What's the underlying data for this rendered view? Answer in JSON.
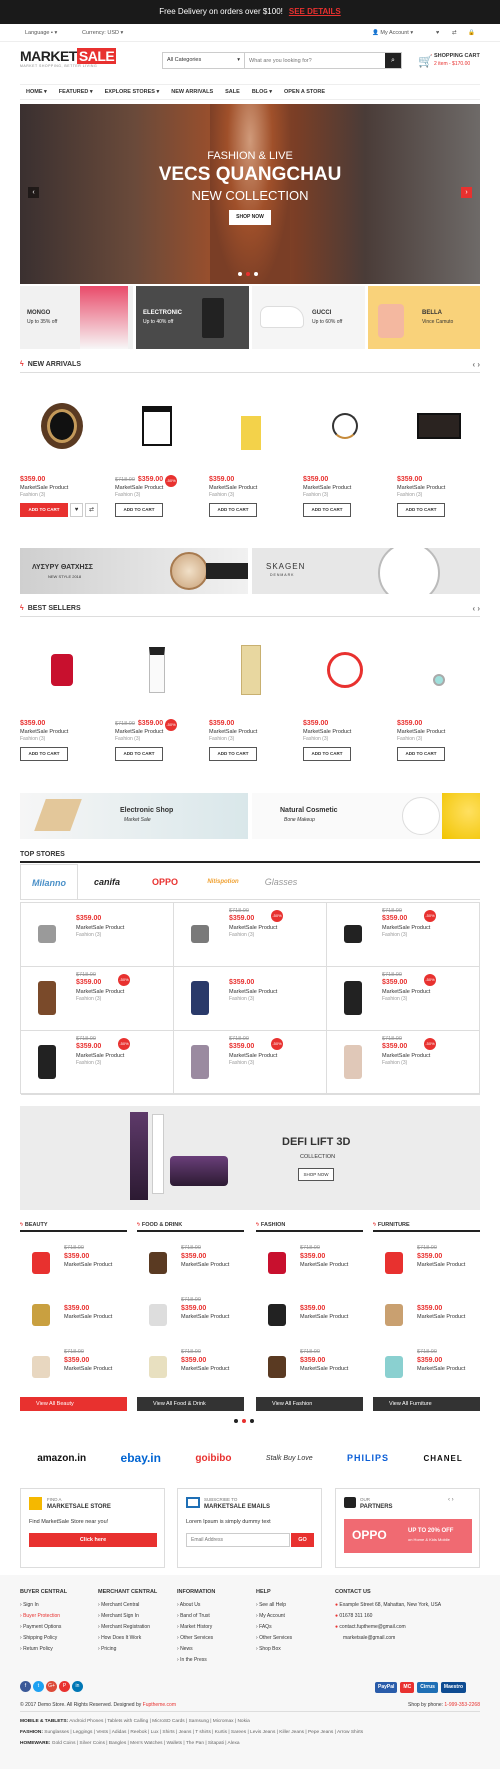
{
  "topbar": {
    "text": "Free Delivery on orders over $100!",
    "link": "SEE DETAILS"
  },
  "util": {
    "language_label": "Language",
    "currency_label": "Currency: USD",
    "account": "My Account"
  },
  "logo": {
    "part1": "MARKET",
    "part2": "SALE",
    "tagline": "MARKET SHOPPING, BETTER LIVING"
  },
  "search": {
    "category": "All Categories",
    "placeholder": "What are you looking for?"
  },
  "cart": {
    "title": "SHOPPING CART",
    "summary": "2 item - $170.00"
  },
  "nav": [
    "HOME",
    "FEATURED",
    "EXPLORE STORES",
    "NEW ARRIVALS",
    "SALE",
    "BLOG",
    "OPEN A STORE"
  ],
  "hero": {
    "line1": "FASHION & LIVE",
    "line2": "VECS QUANGCHAU",
    "line3": "NEW COLLECTION",
    "button": "SHOP NOW"
  },
  "promo_cards": [
    {
      "title": "MONGO",
      "subtitle": "Up to 35% off"
    },
    {
      "title": "ELECTRONIC",
      "subtitle": "Up to 40% off"
    },
    {
      "title": "GUCCI",
      "subtitle": "Up to 60% off"
    },
    {
      "title": "BELLA",
      "subtitle": "Vince Camuto"
    }
  ],
  "new_arrivals": {
    "title": "NEW ARRIVALS",
    "products": [
      {
        "price": "$359.00",
        "old": "",
        "sale": "",
        "name": "MarketSale Product",
        "cat": "Fashion (3)",
        "icon": "watch"
      },
      {
        "price": "$359.00",
        "old": "$718.00",
        "sale": "-50%",
        "name": "MarketSale Product",
        "cat": "Fashion (3)",
        "icon": "side-table"
      },
      {
        "price": "$359.00",
        "old": "",
        "sale": "",
        "name": "MarketSale Product",
        "cat": "Fashion (3)",
        "icon": "diffuser"
      },
      {
        "price": "$359.00",
        "old": "",
        "sale": "",
        "name": "MarketSale Product",
        "cat": "Fashion (3)",
        "icon": "lamp"
      },
      {
        "price": "$359.00",
        "old": "",
        "sale": "",
        "name": "MarketSale Product",
        "cat": "Fashion (3)",
        "icon": "tv-stand"
      }
    ],
    "add_label": "ADD TO CART"
  },
  "mid_banners": {
    "left_title": "ΛΥΣΥΡΥ ΘΑΤΧΗΣΣ",
    "left_sub": "NEW STYLE 2018",
    "right_title": "SKAGEN",
    "right_sub": "DENMARK"
  },
  "best_sellers": {
    "title": "BEST SELLERS",
    "products": [
      {
        "price": "$359.00",
        "old": "",
        "sale": "",
        "name": "MarketSale Product",
        "cat": "Fashion (3)",
        "icon": "perfume"
      },
      {
        "price": "$359.00",
        "old": "$718.00",
        "sale": "-50%",
        "name": "MarketSale Product",
        "cat": "Fashion (3)",
        "icon": "bottle"
      },
      {
        "price": "$359.00",
        "old": "",
        "sale": "",
        "name": "MarketSale Product",
        "cat": "Fashion (3)",
        "icon": "cream"
      },
      {
        "price": "$359.00",
        "old": "",
        "sale": "",
        "name": "MarketSale Product",
        "cat": "Fashion (3)",
        "icon": "hugo"
      },
      {
        "price": "$359.00",
        "old": "",
        "sale": "",
        "name": "MarketSale Product",
        "cat": "Fashion (3)",
        "icon": "earrings"
      }
    ],
    "add_label": "ADD TO CART"
  },
  "shop_banners": {
    "left_title": "Electronic Shop",
    "left_sub": "Market Sale",
    "right_title": "Natural Cosmetic",
    "right_sub": "Bone Makeup"
  },
  "top_stores": {
    "title": "TOP STORES",
    "brands": [
      "Milanno",
      "canifa",
      "OPPO",
      "Nitispotion",
      "Glasses"
    ],
    "items": [
      {
        "old": "",
        "price": "$359.00",
        "badge": "",
        "name": "MarketSale Product",
        "cat": "Fashion (3)"
      },
      {
        "old": "$718.00",
        "price": "$359.00",
        "badge": "-50%",
        "name": "MarketSale Product",
        "cat": "Fashion (3)"
      },
      {
        "old": "$718.00",
        "price": "$359.00",
        "badge": "-50%",
        "name": "MarketSale Product",
        "cat": "Fashion (3)"
      },
      {
        "old": "$718.00",
        "price": "$359.00",
        "badge": "-50%",
        "name": "MarketSale Product",
        "cat": "Fashion (3)"
      },
      {
        "old": "",
        "price": "$359.00",
        "badge": "",
        "name": "MarketSale Product",
        "cat": "Fashion (3)"
      },
      {
        "old": "$718.00",
        "price": "$359.00",
        "badge": "-50%",
        "name": "MarketSale Product",
        "cat": "Fashion (3)"
      },
      {
        "old": "$718.00",
        "price": "$359.00",
        "badge": "-50%",
        "name": "MarketSale Product",
        "cat": "Fashion (3)"
      },
      {
        "old": "$718.00",
        "price": "$359.00",
        "badge": "-50%",
        "name": "MarketSale Product",
        "cat": "Fashion (3)"
      },
      {
        "old": "$718.00",
        "price": "$359.00",
        "badge": "-50%",
        "name": "MarketSale Product",
        "cat": "Fashion (3)"
      }
    ]
  },
  "defi": {
    "title": "DEFI LIFT 3D",
    "sub": "COLLECTION",
    "button": "SHOP NOW"
  },
  "categories": [
    {
      "title": "BEAUTY",
      "view": "View All Beauty",
      "color": "#e8312f",
      "items": [
        {
          "old": "$718.00",
          "price": "$359.00",
          "name": "MarketSale Product"
        },
        {
          "old": "",
          "price": "$359.00",
          "name": "MarketSale Product"
        },
        {
          "old": "$718.00",
          "price": "$359.00",
          "name": "MarketSale Product"
        }
      ]
    },
    {
      "title": "FOOD & DRINK",
      "view": "View All Food & Drink",
      "color": "#333333",
      "items": [
        {
          "old": "$718.00",
          "price": "$359.00",
          "name": "MarketSale Product"
        },
        {
          "old": "$718.00",
          "price": "$359.00",
          "name": "MarketSale Product"
        },
        {
          "old": "$718.00",
          "price": "$359.00",
          "name": "MarketSale Product"
        }
      ]
    },
    {
      "title": "FASHION",
      "view": "View All Fashion",
      "color": "#333333",
      "items": [
        {
          "old": "$718.00",
          "price": "$359.00",
          "name": "MarketSale Product"
        },
        {
          "old": "",
          "price": "$359.00",
          "name": "MarketSale Product"
        },
        {
          "old": "$718.00",
          "price": "$359.00",
          "name": "MarketSale Product"
        }
      ]
    },
    {
      "title": "FURNITURE",
      "view": "View All Furniture",
      "color": "#333333",
      "items": [
        {
          "old": "$718.00",
          "price": "$359.00",
          "name": "MarketSale Product"
        },
        {
          "old": "",
          "price": "$359.00",
          "name": "MarketSale Product"
        },
        {
          "old": "$718.00",
          "price": "$359.00",
          "name": "MarketSale Product"
        }
      ]
    }
  ],
  "brand_logos": [
    "amazon.in",
    "ebay.in",
    "goibibo",
    "Stalk Buy Love",
    "PHILIPS",
    "CHANEL"
  ],
  "panels": {
    "find": {
      "small": "FIND A",
      "title": "MARKETSALE STORE",
      "text": "Find MarketSale Store near you!",
      "button": "Click here"
    },
    "subscribe": {
      "small": "SUBSCRIBE TO",
      "title": "MARKETSALE EMAILS",
      "text": "Lorem Ipsum is simply dummy text",
      "placeholder": "Email Address",
      "button": "GO"
    },
    "partners": {
      "small": "OUR",
      "title": "PARTNERS",
      "brand": "OPPO",
      "deal1": "UP TO 20% OFF",
      "deal2": "on Home & Kids Mobile"
    }
  },
  "footer": {
    "cols": [
      {
        "title": "BUYER CENTRAL",
        "links": [
          "Sign In",
          "Buyer Protection",
          "Payment Options",
          "Shipping Policy",
          "Return Policy"
        ]
      },
      {
        "title": "MERCHANT CENTRAL",
        "links": [
          "Merchant Central",
          "Merchant Sign In",
          "Merchant Registration",
          "How Does It Work",
          "Pricing"
        ]
      },
      {
        "title": "INFORMATION",
        "links": [
          "About Us",
          "Band of Trust",
          "Market History",
          "Other Services",
          "News",
          "In the Press"
        ]
      },
      {
        "title": "HELP",
        "links": [
          "See all Help",
          "My Account",
          "FAQs",
          "Other Services",
          "Shop Box"
        ]
      }
    ],
    "contact": {
      "title": "CONTACT US",
      "address": "Example Street 68, Mahattan, New York, USA",
      "phone": "01678 311 160",
      "email1": "contact.fuptheme@gmail.com",
      "email2": "marketsale@gmail.com"
    },
    "social": [
      "f",
      "t",
      "G+",
      "P",
      "in"
    ],
    "payments": [
      {
        "name": "PayPal",
        "color": "#2a5caa"
      },
      {
        "name": "MC",
        "color": "#e8312f"
      },
      {
        "name": "Cirrus",
        "color": "#1f6fb5"
      },
      {
        "name": "Maestro",
        "color": "#0e4c92"
      }
    ],
    "copyright": "© 2017 Demo Store. All Rights Reserved. Designed by",
    "copyright_link": "Fuptheme.com",
    "phone_label": "Shop by phone",
    "phone": "1-999-353-2268",
    "rows": [
      {
        "label": "MOBILE & TABLETS:",
        "text": "Android Phones | Tablets with Calling | MicroSD Cards | Samsung | Micromax | Nokia"
      },
      {
        "label": "FASHION:",
        "text": "Sunglasses | Leggings | Vests | Adidas | Reebok | Lux | Shirts | Jeans | T shirts | Kurtis | Sarees | Levis Jeans | Killer Jeans | Pepe Jeans | Arrow Shirts"
      },
      {
        "label": "HOMEWARE:",
        "text": "Gold Coins | Silver Coins | Bangles | Men's Watches | Wallets | The Pan | Sitapati | Alexa"
      }
    ]
  }
}
